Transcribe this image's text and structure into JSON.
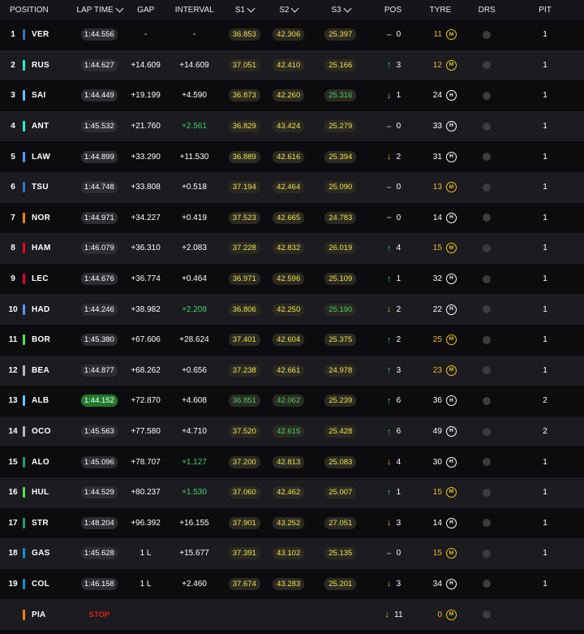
{
  "header": {
    "position": "POSITION",
    "lap_time": "LAP TIME",
    "gap": "GAP",
    "interval": "INTERVAL",
    "s1": "S1",
    "s2": "S2",
    "s3": "S3",
    "pos": "POS",
    "tyre": "TYRE",
    "drs": "DRS",
    "pit": "PIT"
  },
  "colors": {
    "sector_yellow": "#f0e04a",
    "sector_green": "#43d163",
    "best_lap_green": "#1e7a2a",
    "gain_green": "#3fcf5e",
    "loss_amber": "#f0b72d",
    "stop_red": "#e01e1e"
  },
  "drivers": [
    {
      "pos": "1",
      "code": "VER",
      "team_color": "#3671c6",
      "lap": "1:44.556",
      "lap_best": false,
      "gap": "-",
      "interval": "-",
      "interval_green": false,
      "s1": "36.853",
      "s1c": "y",
      "s2": "42.306",
      "s2c": "y",
      "s3": "25.397",
      "s3c": "y",
      "dir": "same",
      "pos_change": "0",
      "tyre_laps": "11",
      "tyre_used": true,
      "tyre": "M",
      "tyre_icon": "medium-tyre-icon",
      "pit": "1"
    },
    {
      "pos": "2",
      "code": "RUS",
      "team_color": "#27f4d2",
      "lap": "1:44.627",
      "lap_best": false,
      "gap": "+14.609",
      "interval": "+14.609",
      "interval_green": false,
      "s1": "37.051",
      "s1c": "y",
      "s2": "42.410",
      "s2c": "y",
      "s3": "25.166",
      "s3c": "y",
      "dir": "up",
      "pos_change": "3",
      "tyre_laps": "12",
      "tyre_used": true,
      "tyre": "M",
      "tyre_icon": "medium-tyre-icon",
      "pit": "1"
    },
    {
      "pos": "3",
      "code": "SAI",
      "team_color": "#64c4ff",
      "lap": "1:44.449",
      "lap_best": false,
      "gap": "+19.199",
      "interval": "+4.590",
      "interval_green": false,
      "s1": "36.873",
      "s1c": "y",
      "s2": "42.260",
      "s2c": "y",
      "s3": "25.316",
      "s3c": "g",
      "dir": "down",
      "pos_change": "1",
      "tyre_laps": "24",
      "tyre_used": false,
      "tyre": "H",
      "tyre_icon": "hard-tyre-icon",
      "pit": "1"
    },
    {
      "pos": "4",
      "code": "ANT",
      "team_color": "#27f4d2",
      "lap": "1:45.532",
      "lap_best": false,
      "gap": "+21.760",
      "interval": "+2.561",
      "interval_green": true,
      "s1": "36.829",
      "s1c": "y",
      "s2": "43.424",
      "s2c": "y",
      "s3": "25.279",
      "s3c": "y",
      "dir": "same",
      "pos_change": "0",
      "tyre_laps": "33",
      "tyre_used": false,
      "tyre": "H",
      "tyre_icon": "hard-tyre-icon",
      "pit": "1"
    },
    {
      "pos": "5",
      "code": "LAW",
      "team_color": "#6692ff",
      "lap": "1:44.899",
      "lap_best": false,
      "gap": "+33.290",
      "interval": "+11.530",
      "interval_green": false,
      "s1": "36.889",
      "s1c": "y",
      "s2": "42.616",
      "s2c": "y",
      "s3": "25.394",
      "s3c": "y",
      "dir": "down",
      "pos_change": "2",
      "tyre_laps": "31",
      "tyre_used": false,
      "tyre": "H",
      "tyre_icon": "hard-tyre-icon",
      "pit": "1"
    },
    {
      "pos": "6",
      "code": "TSU",
      "team_color": "#3671c6",
      "lap": "1:44.748",
      "lap_best": false,
      "gap": "+33.808",
      "interval": "+0.518",
      "interval_green": false,
      "s1": "37.194",
      "s1c": "y",
      "s2": "42.464",
      "s2c": "y",
      "s3": "25.090",
      "s3c": "y",
      "dir": "same",
      "pos_change": "0",
      "tyre_laps": "13",
      "tyre_used": true,
      "tyre": "M",
      "tyre_icon": "medium-tyre-icon",
      "pit": "1"
    },
    {
      "pos": "7",
      "code": "NOR",
      "team_color": "#ff8000",
      "lap": "1:44.971",
      "lap_best": false,
      "gap": "+34.227",
      "interval": "+0.419",
      "interval_green": false,
      "s1": "37.523",
      "s1c": "y",
      "s2": "42.665",
      "s2c": "y",
      "s3": "24.783",
      "s3c": "y",
      "dir": "same",
      "pos_change": "0",
      "tyre_laps": "14",
      "tyre_used": false,
      "tyre": "H",
      "tyre_icon": "hard-tyre-icon",
      "pit": "1"
    },
    {
      "pos": "8",
      "code": "HAM",
      "team_color": "#e8002d",
      "lap": "1:46.079",
      "lap_best": false,
      "gap": "+36.310",
      "interval": "+2.083",
      "interval_green": false,
      "s1": "37.228",
      "s1c": "y",
      "s2": "42.832",
      "s2c": "y",
      "s3": "26.019",
      "s3c": "y",
      "dir": "up",
      "pos_change": "4",
      "tyre_laps": "15",
      "tyre_used": true,
      "tyre": "M",
      "tyre_icon": "medium-tyre-icon",
      "pit": "1"
    },
    {
      "pos": "9",
      "code": "LEC",
      "team_color": "#e8002d",
      "lap": "1:44.676",
      "lap_best": false,
      "gap": "+36.774",
      "interval": "+0.464",
      "interval_green": false,
      "s1": "36.971",
      "s1c": "y",
      "s2": "42.596",
      "s2c": "y",
      "s3": "25.109",
      "s3c": "y",
      "dir": "up",
      "pos_change": "1",
      "tyre_laps": "32",
      "tyre_used": false,
      "tyre": "H",
      "tyre_icon": "hard-tyre-icon",
      "pit": "1"
    },
    {
      "pos": "10",
      "code": "HAD",
      "team_color": "#6692ff",
      "lap": "1:44.246",
      "lap_best": false,
      "gap": "+38.982",
      "interval": "+2.208",
      "interval_green": true,
      "s1": "36.806",
      "s1c": "y",
      "s2": "42.250",
      "s2c": "y",
      "s3": "25.190",
      "s3c": "g",
      "dir": "down",
      "pos_change": "2",
      "tyre_laps": "22",
      "tyre_used": false,
      "tyre": "H",
      "tyre_icon": "hard-tyre-icon",
      "pit": "1"
    },
    {
      "pos": "11",
      "code": "BOR",
      "team_color": "#52e252",
      "lap": "1:45.380",
      "lap_best": false,
      "gap": "+67.606",
      "interval": "+28.624",
      "interval_green": false,
      "s1": "37.401",
      "s1c": "y",
      "s2": "42.604",
      "s2c": "y",
      "s3": "25.375",
      "s3c": "y",
      "dir": "up",
      "pos_change": "2",
      "tyre_laps": "25",
      "tyre_used": true,
      "tyre": "M",
      "tyre_icon": "medium-tyre-icon",
      "pit": "1"
    },
    {
      "pos": "12",
      "code": "BEA",
      "team_color": "#b6babd",
      "lap": "1:44.877",
      "lap_best": false,
      "gap": "+68.262",
      "interval": "+0.656",
      "interval_green": false,
      "s1": "37.238",
      "s1c": "y",
      "s2": "42.661",
      "s2c": "y",
      "s3": "24.978",
      "s3c": "y",
      "dir": "up",
      "pos_change": "3",
      "tyre_laps": "23",
      "tyre_used": true,
      "tyre": "M",
      "tyre_icon": "medium-tyre-icon",
      "pit": "1"
    },
    {
      "pos": "13",
      "code": "ALB",
      "team_color": "#64c4ff",
      "lap": "1:44.152",
      "lap_best": true,
      "gap": "+72.870",
      "interval": "+4.608",
      "interval_green": false,
      "s1": "36.851",
      "s1c": "g",
      "s2": "42.062",
      "s2c": "g",
      "s3": "25.239",
      "s3c": "y",
      "dir": "up",
      "pos_change": "6",
      "tyre_laps": "36",
      "tyre_used": false,
      "tyre": "H",
      "tyre_icon": "hard-tyre-icon",
      "pit": "2"
    },
    {
      "pos": "14",
      "code": "OCO",
      "team_color": "#b6babd",
      "lap": "1:45.563",
      "lap_best": false,
      "gap": "+77.580",
      "interval": "+4.710",
      "interval_green": false,
      "s1": "37.520",
      "s1c": "y",
      "s2": "42.615",
      "s2c": "g",
      "s3": "25.428",
      "s3c": "y",
      "dir": "up",
      "pos_change": "6",
      "tyre_laps": "49",
      "tyre_used": false,
      "tyre": "H",
      "tyre_icon": "hard-tyre-icon",
      "pit": "2"
    },
    {
      "pos": "15",
      "code": "ALO",
      "team_color": "#229971",
      "lap": "1:45.096",
      "lap_best": false,
      "gap": "+78.707",
      "interval": "+1.127",
      "interval_green": true,
      "s1": "37.200",
      "s1c": "y",
      "s2": "42.813",
      "s2c": "y",
      "s3": "25.083",
      "s3c": "y",
      "dir": "down",
      "pos_change": "4",
      "tyre_laps": "30",
      "tyre_used": false,
      "tyre": "H",
      "tyre_icon": "hard-tyre-icon",
      "pit": "1"
    },
    {
      "pos": "16",
      "code": "HUL",
      "team_color": "#52e252",
      "lap": "1:44.529",
      "lap_best": false,
      "gap": "+80.237",
      "interval": "+1.530",
      "interval_green": true,
      "s1": "37.060",
      "s1c": "y",
      "s2": "42.462",
      "s2c": "y",
      "s3": "25.007",
      "s3c": "y",
      "dir": "up",
      "pos_change": "1",
      "tyre_laps": "15",
      "tyre_used": true,
      "tyre": "M",
      "tyre_icon": "medium-tyre-icon",
      "pit": "1"
    },
    {
      "pos": "17",
      "code": "STR",
      "team_color": "#229971",
      "lap": "1:48.204",
      "lap_best": false,
      "gap": "+96.392",
      "interval": "+16.155",
      "interval_green": false,
      "s1": "37.901",
      "s1c": "y",
      "s2": "43.252",
      "s2c": "y",
      "s3": "27.051",
      "s3c": "y",
      "dir": "down",
      "pos_change": "3",
      "tyre_laps": "14",
      "tyre_used": false,
      "tyre": "H",
      "tyre_icon": "hard-tyre-icon",
      "pit": "1"
    },
    {
      "pos": "18",
      "code": "GAS",
      "team_color": "#0093cc",
      "lap": "1:45.628",
      "lap_best": false,
      "gap": "1 L",
      "interval": "+15.677",
      "interval_green": false,
      "s1": "37.391",
      "s1c": "y",
      "s2": "43.102",
      "s2c": "y",
      "s3": "25.135",
      "s3c": "y",
      "dir": "same",
      "pos_change": "0",
      "tyre_laps": "15",
      "tyre_used": true,
      "tyre": "M",
      "tyre_icon": "medium-tyre-icon",
      "pit": "1"
    },
    {
      "pos": "19",
      "code": "COL",
      "team_color": "#0093cc",
      "lap": "1:46.158",
      "lap_best": false,
      "gap": "1 L",
      "interval": "+2.460",
      "interval_green": false,
      "s1": "37.674",
      "s1c": "y",
      "s2": "43.283",
      "s2c": "y",
      "s3": "25.201",
      "s3c": "y",
      "dir": "down",
      "pos_change": "3",
      "tyre_laps": "34",
      "tyre_used": false,
      "tyre": "H",
      "tyre_icon": "hard-tyre-icon",
      "pit": "1"
    },
    {
      "pos": "",
      "code": "PIA",
      "team_color": "#ff8000",
      "stop": "STOP",
      "lap": "",
      "lap_best": false,
      "gap": "",
      "interval": "",
      "interval_green": false,
      "s1": "",
      "s1c": "y",
      "s2": "",
      "s2c": "y",
      "s3": "",
      "s3c": "y",
      "dir": "down",
      "pos_change": "11",
      "tyre_laps": "0",
      "tyre_used": true,
      "tyre": "M",
      "tyre_icon": "medium-tyre-icon",
      "pit": ""
    }
  ]
}
